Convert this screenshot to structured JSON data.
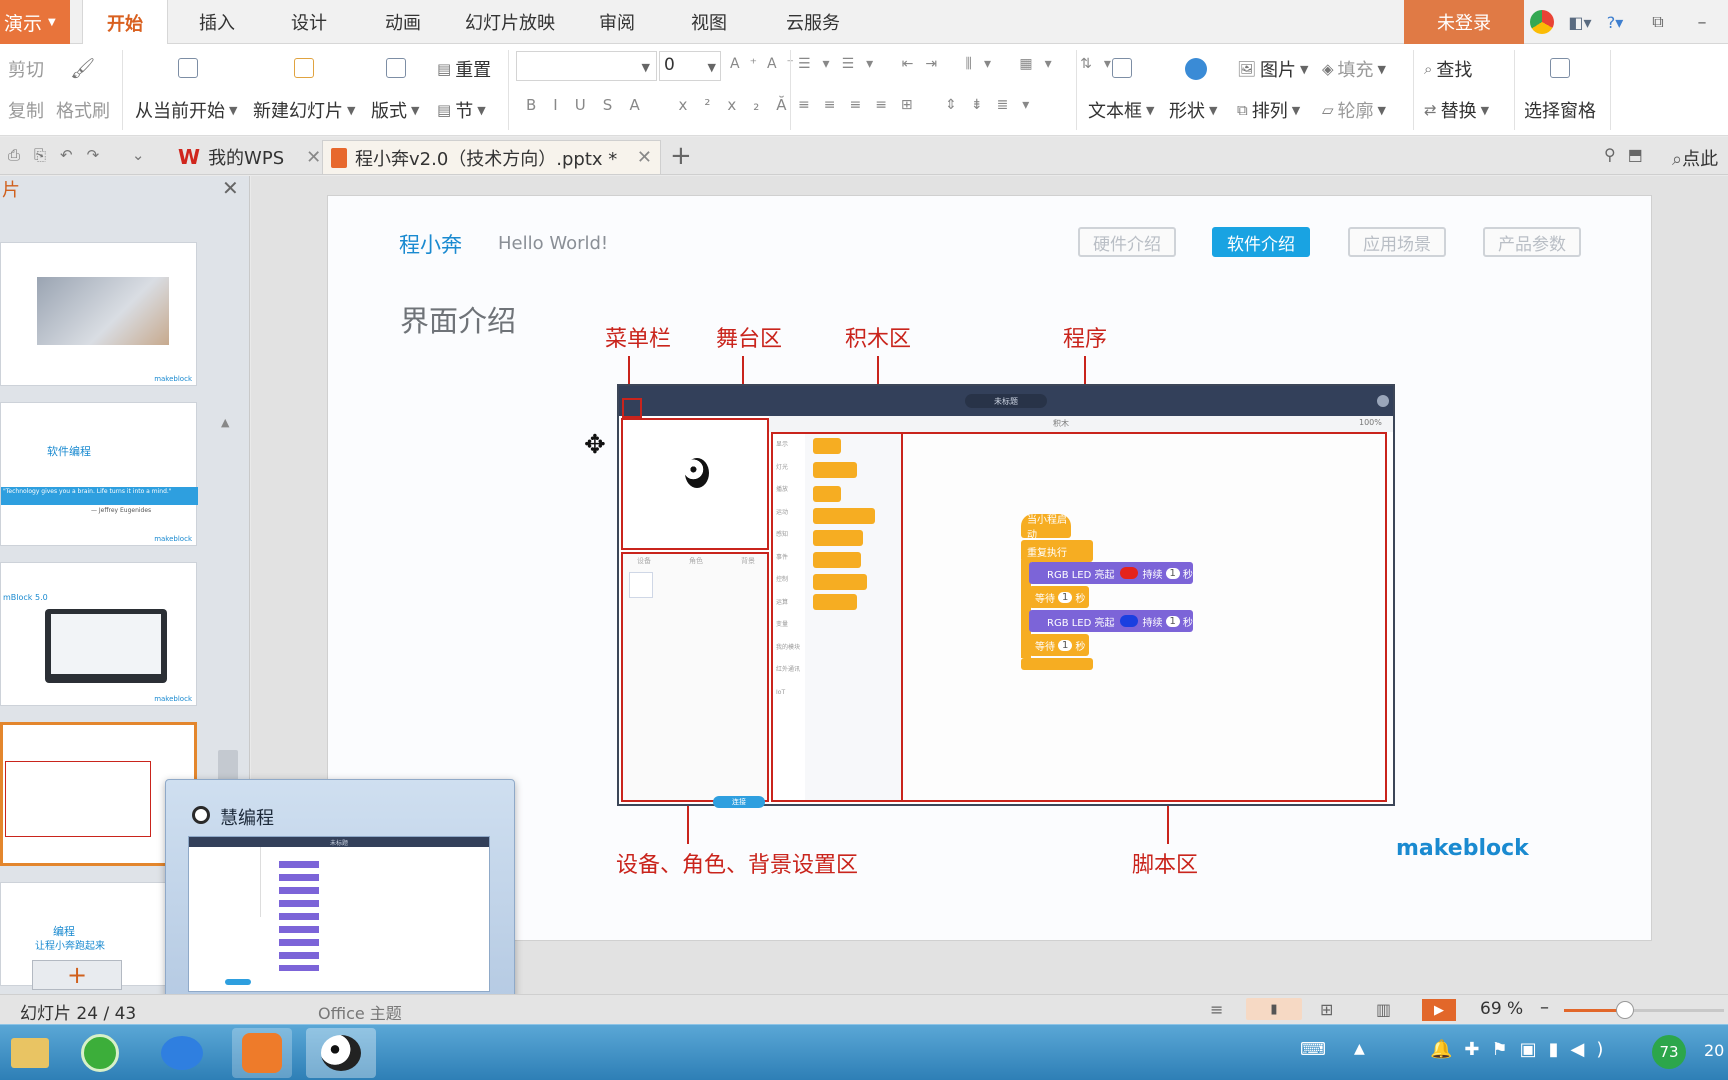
{
  "menubar": {
    "app_label": "演示",
    "tabs": [
      "开始",
      "插入",
      "设计",
      "动画",
      "幻灯片放映",
      "审阅",
      "视图",
      "云服务"
    ],
    "login": "未登录"
  },
  "ribbon": {
    "cut": "剪切",
    "copy": "复制",
    "format_painter": "格式刷",
    "from_current": "从当前开始",
    "new_slide": "新建幻灯片",
    "layout": "版式",
    "reset": "重置",
    "section": "节",
    "font_size": "0",
    "textbox": "文本框",
    "shape": "形状",
    "picture": "图片",
    "fill": "填充",
    "arrange": "排列",
    "outline": "轮廓",
    "find": "查找",
    "replace": "替换",
    "selection_pane": "选择窗格"
  },
  "tabsbar": {
    "wps_tab": "我的WPS",
    "doc_tab": "程小奔v2.0（技术方向）.pptx *",
    "right_text": "点此"
  },
  "panel": {
    "title": "片",
    "thumb2_text": "软件编程",
    "thumb2_quote": "\"Technology gives you a brain. Life turns it into a mind.\"",
    "thumb2_author": "— Jeffrey Eugenides",
    "thumb3_text": "mBlock 5.0",
    "thumb5_line1": "编程",
    "thumb5_line2": "让程小奔跑起来",
    "logo_small": "makeblock"
  },
  "slide": {
    "brand": "程小奔",
    "hello": "Hello World!",
    "nav": [
      "硬件介绍",
      "软件介绍",
      "应用场景",
      "产品参数"
    ],
    "title": "界面介绍",
    "labels": {
      "menu": "菜单栏",
      "stage": "舞台区",
      "blocks": "积木区",
      "program": "程序",
      "device": "设备、角色、背景设置区",
      "script": "脚本区"
    },
    "logo": "makeblock",
    "mock": {
      "title": "未标题",
      "blocks_dropdown": "积木",
      "zoom": "100%",
      "categories": [
        "显示",
        "灯光",
        "播放",
        "运动",
        "感知",
        "事件",
        "控制",
        "运算",
        "变量",
        "我的模块",
        "红外通讯",
        "IoT"
      ],
      "tabs": [
        "设备",
        "角色",
        "背景"
      ],
      "connect": "连接",
      "prog": {
        "start": "当小程启动",
        "loop": "重复执行",
        "led1": "RGB LED 亮起",
        "dur": "持续",
        "sec": "秒",
        "wait": "等待",
        "one": "1",
        "led2": "RGB LED 亮起"
      }
    }
  },
  "popup": {
    "title": "慧编程",
    "mock_title": "未标题"
  },
  "status": {
    "slide_count": "幻灯片 24 / 43",
    "theme": "Office 主题",
    "zoom": "69 %"
  },
  "taskbar": {
    "battery": "73",
    "clock": "20"
  },
  "colors": {
    "accent": "#e8743b",
    "slide_blue": "#19a3e2",
    "annotation_red": "#c9241c"
  }
}
